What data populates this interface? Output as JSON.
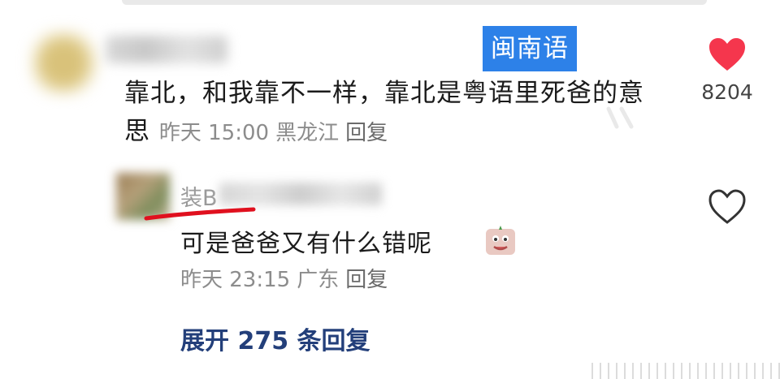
{
  "badge": {
    "label": "闽南语",
    "color": "#2d81e8"
  },
  "comment1": {
    "text": "靠北，和我靠不一样，靠北是粤语里死爸的意思",
    "time": "昨天 15:00",
    "location": "黑龙江",
    "reply_label": "回复",
    "likes": "8204",
    "liked": true,
    "like_color": "#f5364d"
  },
  "reply1": {
    "username_visible": "装B",
    "text": "可是爸爸又有什么错呢",
    "time": "昨天 23:15",
    "location": "广东",
    "reply_label": "回复",
    "liked": false,
    "annotation_color": "#e0101e"
  },
  "expand_label": "展开 275 条回复",
  "icons": {
    "like_filled": "heart-filled-icon",
    "like_outline": "heart-outline-icon",
    "sticker": "sticker-emoji-icon"
  }
}
